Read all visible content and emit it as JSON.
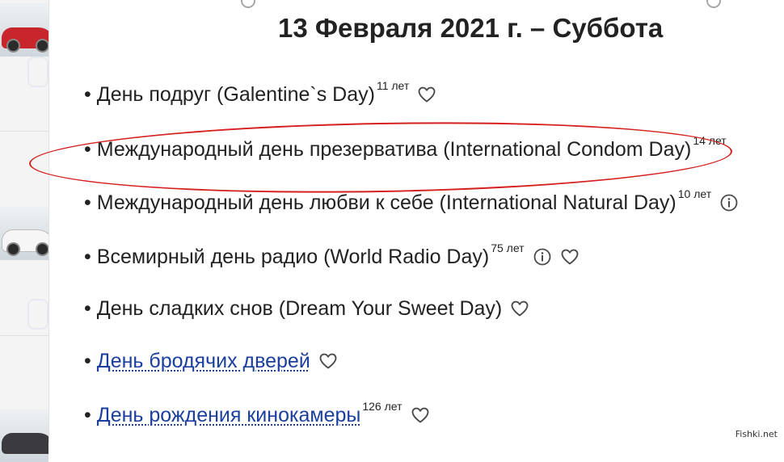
{
  "header": {
    "date_title": "13 Февраля 2021 г. – Суббота"
  },
  "bullet": "•",
  "holidays": [
    {
      "name": "День подруг (Galentine`s Day)",
      "years": "11 лет",
      "info": false,
      "heart": true,
      "link": false
    },
    {
      "name": "Международный день презерватива (International Condom Day)",
      "years": "14 лет",
      "info": false,
      "heart": false,
      "link": false
    },
    {
      "name": "Международный день любви к себе (International Natural Day)",
      "years": "10 лет",
      "info": true,
      "heart": false,
      "link": false
    },
    {
      "name": "Всемирный день радио (World Radio Day)",
      "years": "75 лет",
      "info": true,
      "heart": true,
      "link": false
    },
    {
      "name": "День сладких снов (Dream Your Sweet Day)",
      "years": "",
      "info": false,
      "heart": true,
      "link": false
    },
    {
      "name": "День бродячих дверей",
      "years": "",
      "info": false,
      "heart": true,
      "link": true
    },
    {
      "name": "День рождения кинокамеры",
      "years": "126 лет",
      "info": false,
      "heart": true,
      "link": true
    }
  ],
  "highlight_index": 1,
  "colors": {
    "link": "#1a3f9e",
    "highlight_ellipse": "#d61f1f",
    "text": "#222222"
  },
  "sidebar": {
    "thumbnails": [
      "red-car-icon",
      "white-car-icon",
      "dark-car-icon"
    ]
  },
  "icons": {
    "favorite": "heart-icon",
    "info": "info-icon"
  },
  "watermark": "Fishki.net"
}
